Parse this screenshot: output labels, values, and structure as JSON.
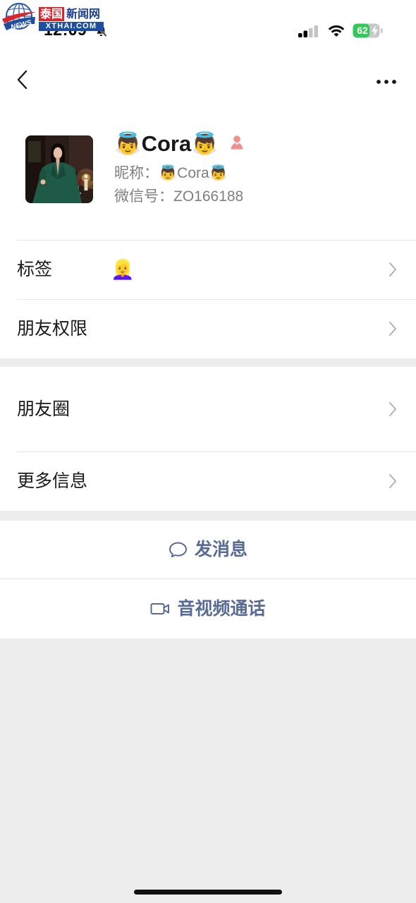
{
  "watermark": {
    "badge": "NEWS",
    "title_highlight": "泰国",
    "title_rest": "新闻网",
    "url": "XTHAI.COM"
  },
  "status_bar": {
    "time": "12:09",
    "battery_percent": "62",
    "battery_level": 0.62,
    "charging": true,
    "signal_bars": 2,
    "signal_bars_total": 4,
    "icons": {
      "mute": "bell-slash-icon",
      "signal": "cellular-signal-icon",
      "wifi": "wifi-icon",
      "battery": "battery-icon",
      "charging": "charging-bolt-icon"
    }
  },
  "nav": {
    "back_icon": "chevron-left-icon",
    "more_icon": "more-dots-icon"
  },
  "profile": {
    "display_name": "👼Cora👼",
    "gender_icon": "female-gender-icon",
    "nickname_label": "昵称：",
    "nickname": "👼Cora👼",
    "wechat_id_label": "微信号：",
    "wechat_id": "ZO166188"
  },
  "groups": [
    {
      "rows": [
        {
          "label": "标签",
          "value": "👱‍♀️",
          "icon": "chevron-right-icon"
        },
        {
          "label": "朋友权限",
          "icon": "chevron-right-icon"
        }
      ]
    },
    {
      "rows": [
        {
          "label": "朋友圈",
          "icon": "chevron-right-icon"
        },
        {
          "label": "更多信息",
          "icon": "chevron-right-icon"
        }
      ]
    }
  ],
  "actions": [
    {
      "label": "发消息",
      "icon": "chat-bubble-icon"
    },
    {
      "label": "音视频通话",
      "icon": "video-call-icon"
    }
  ],
  "colors": {
    "background": "#EDEDED",
    "surface": "#FFFFFF",
    "text_primary": "#191919",
    "text_secondary": "#7F7F7F",
    "link_accent": "#576B95",
    "chevron": "#B2B2B2",
    "divider": "#E5E5E5",
    "female_icon": "#F18E8E",
    "battery_charging": "#34C759"
  }
}
